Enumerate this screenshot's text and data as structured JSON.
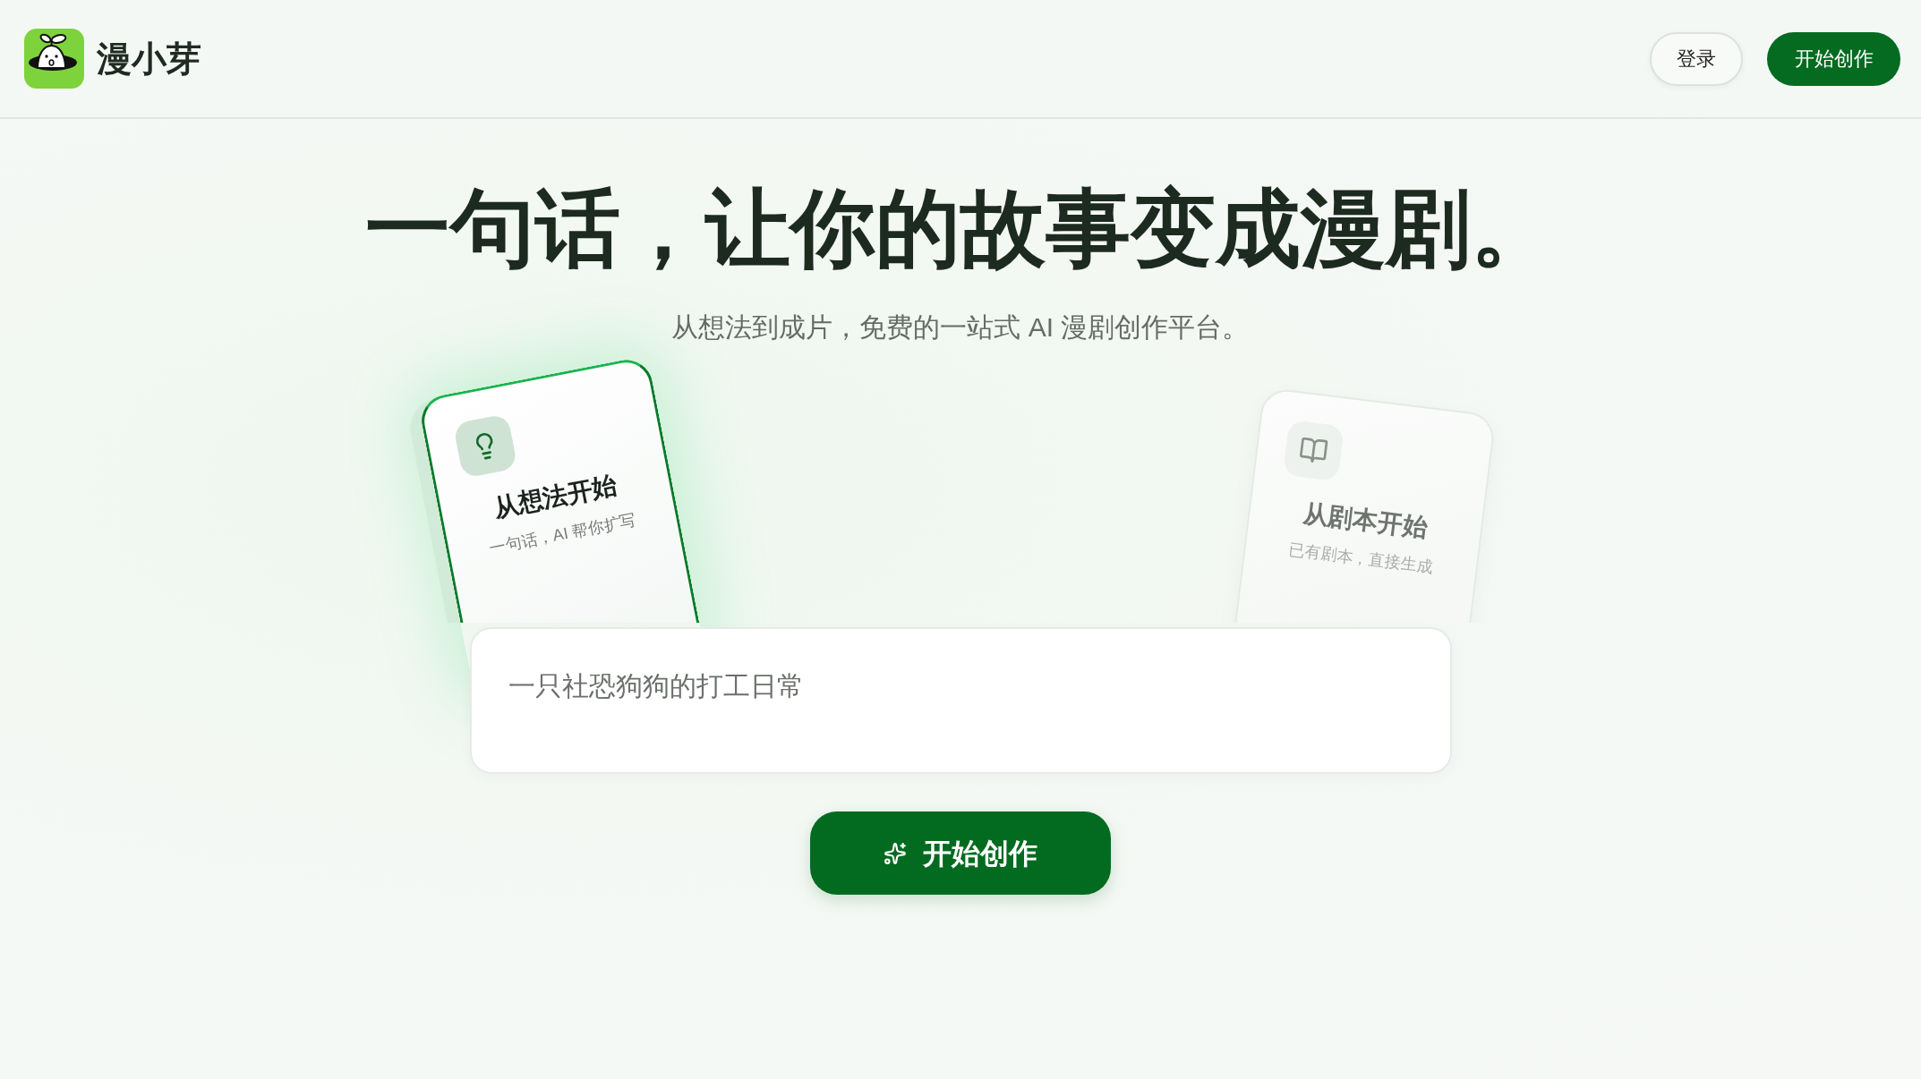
{
  "header": {
    "brand": {
      "name": "漫小芽"
    },
    "buttons": [
      {
        "label": "登录",
        "kind": "outline"
      },
      {
        "label": "开始创作",
        "kind": "primary"
      }
    ]
  },
  "hero": {
    "title": "一句话，让你的故事变成漫剧。",
    "subtitle": "从想法到成片，免费的一站式 AI 漫剧创作平台。"
  },
  "mode_cards": [
    {
      "title": "从想法开始",
      "description": "一句话，AI 帮你扩写",
      "selected": true
    },
    {
      "title": "从剧本开始",
      "description": "已有剧本，直接生成",
      "selected": false
    }
  ],
  "prompt": {
    "placeholder": "一只社恐狗狗的打工日常"
  },
  "submit_button": {
    "label": "开始创作"
  }
}
